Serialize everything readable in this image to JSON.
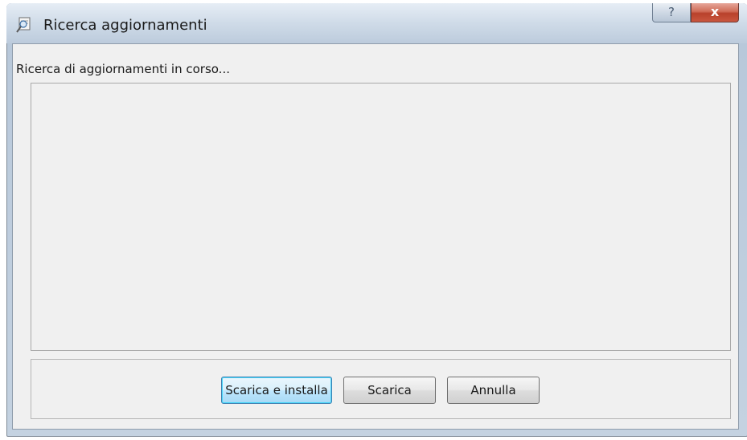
{
  "window": {
    "title": "Ricerca aggiornamenti",
    "help_label": "?",
    "close_label": "x"
  },
  "status": {
    "text": "Ricerca di aggiornamenti in corso..."
  },
  "buttons": {
    "install_label": "Scarica e installa",
    "download_label": "Scarica",
    "cancel_label": "Annulla"
  }
}
